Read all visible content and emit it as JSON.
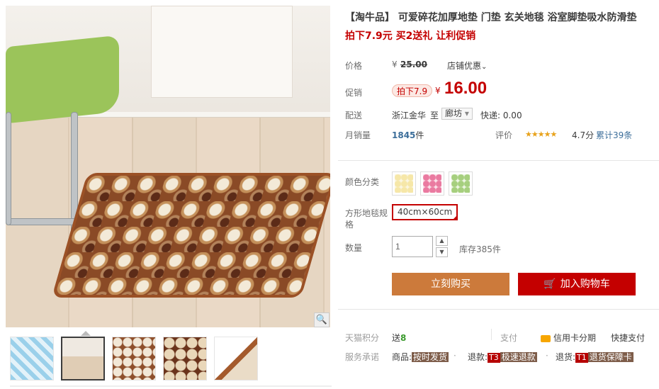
{
  "product": {
    "title": "【淘牛品】 可爱碎花加厚地垫 门垫 玄关地毯 浴室脚垫吸水防滑垫",
    "subtitle": "拍下7.9元 买2送礼 让利促销"
  },
  "price": {
    "label": "价格",
    "currency": "¥",
    "original": "25.00",
    "discount_link": "店铺优惠",
    "promo_label": "促销",
    "promo_tag": "拍下7.9",
    "promo_price": "16.00"
  },
  "shipping": {
    "label": "配送",
    "from": "浙江金华",
    "to_word": "至",
    "destination": "廊坊",
    "fee": "快递: 0.00"
  },
  "sales": {
    "label": "月销量",
    "count": "1845",
    "unit": "件",
    "rating_label": "评价",
    "stars": "★★★★★",
    "score": "4.7分",
    "reviews": "累计39条"
  },
  "options": {
    "color_label": "颜色分类",
    "size_label": "方形地毯规格",
    "size_value": "40cm×60cm",
    "qty_label": "数量",
    "qty_value": "1",
    "stock": "库存385件"
  },
  "actions": {
    "buy_now": "立刻购买",
    "add_to_cart": "加入购物车",
    "cart_icon": "🛒"
  },
  "footer": {
    "points_label": "天猫积分",
    "points_value": "送",
    "points_num": "8",
    "pay_label": "支付",
    "credit": "信用卡分期",
    "quick_pay": "快捷支付",
    "promise_label": "服务承诺",
    "goods_label": "商品:",
    "goods_tag": "按时发货",
    "refund_label": "退款:",
    "refund_code": "T3",
    "refund_tag": "极速退款",
    "return_label": "退货:",
    "return_code": "T1",
    "return_tag": "退货保障卡",
    "dot": "·"
  },
  "icons": {
    "zoom": "🔍",
    "chevron": "⌄",
    "up": "▲",
    "down": "▼",
    "select_arrow": "▾"
  },
  "colors": {
    "price_red": "#c40000",
    "buy_orange": "#cc7a3b",
    "star": "#e8a21b"
  }
}
